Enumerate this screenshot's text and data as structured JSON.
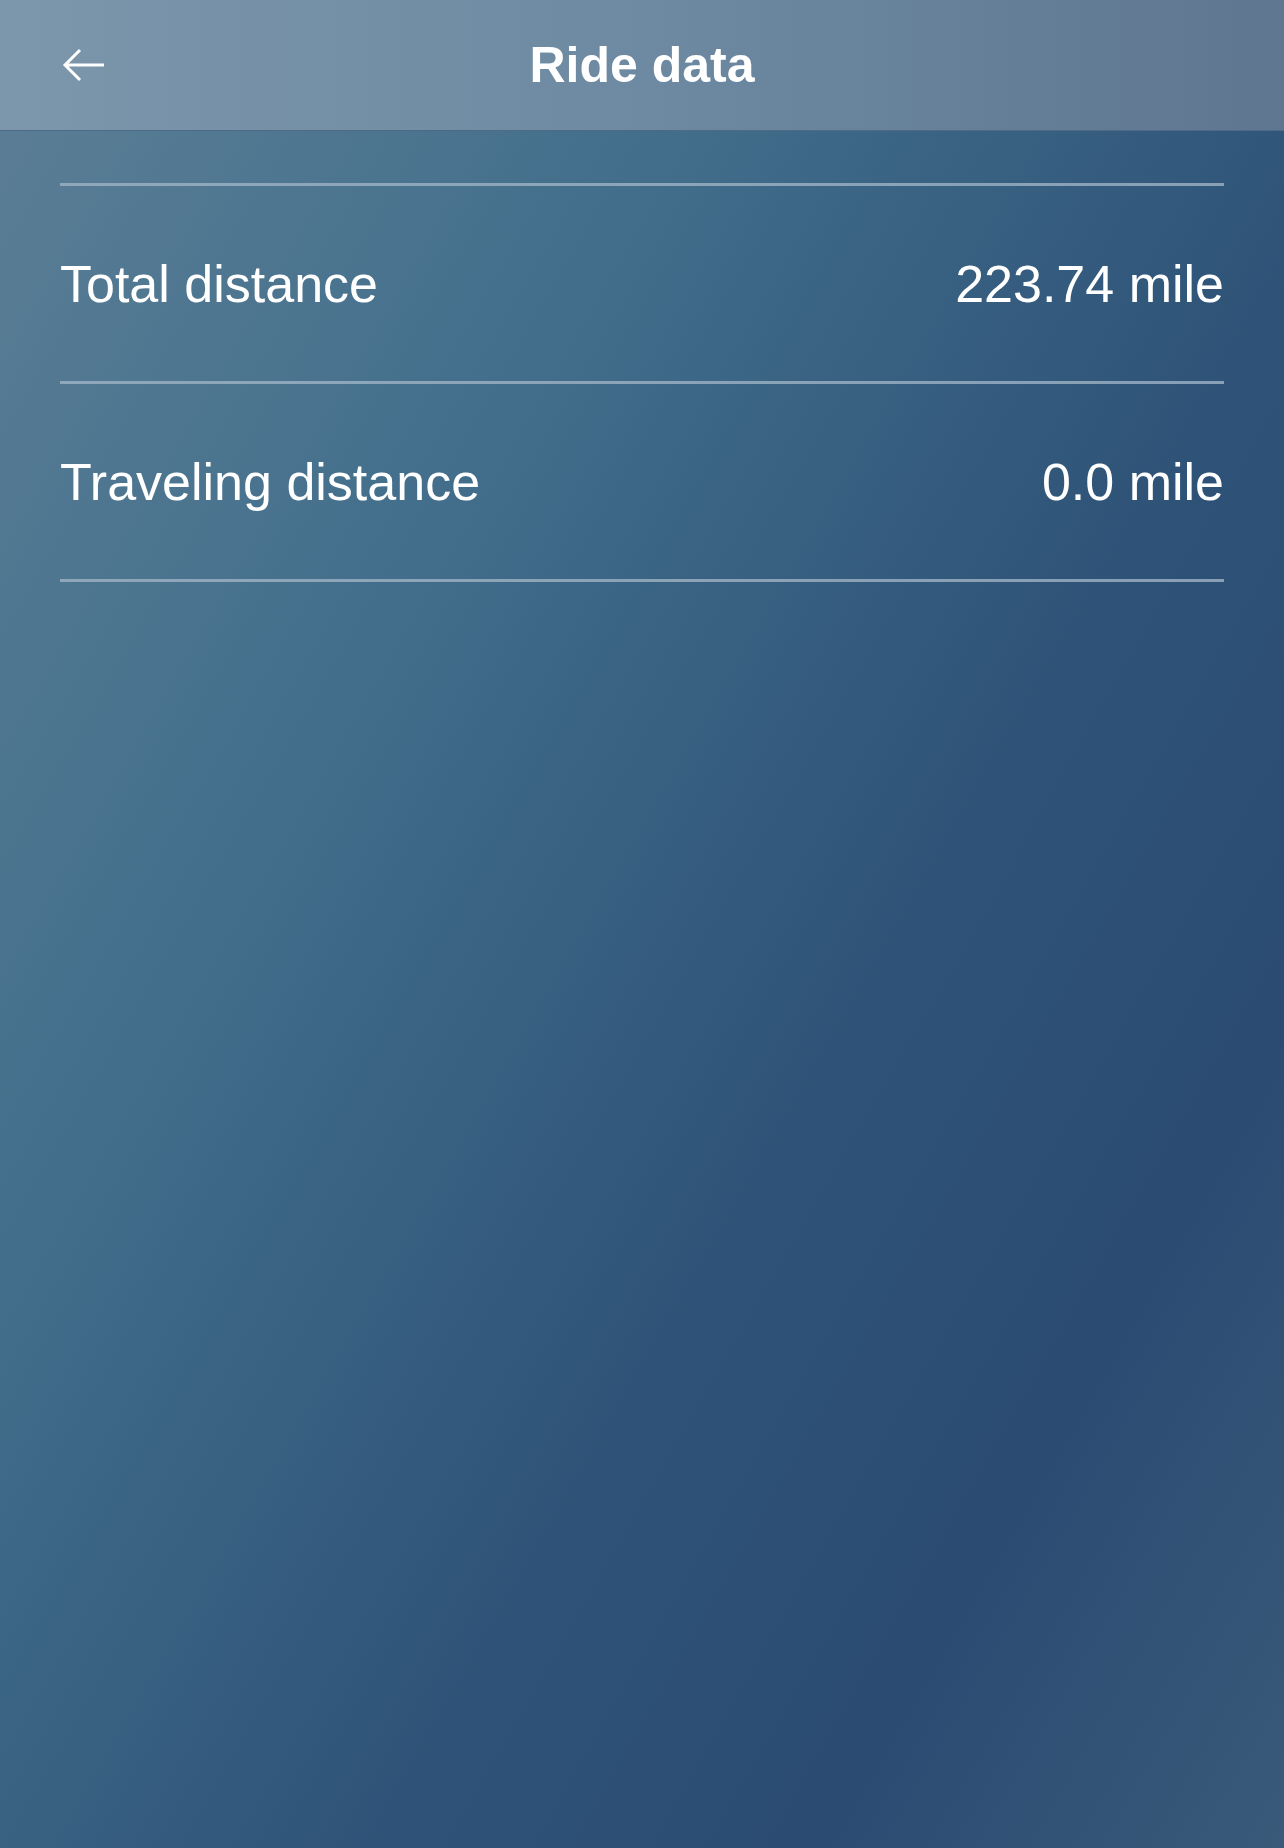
{
  "header": {
    "title": "Ride data"
  },
  "rows": [
    {
      "label": "Total distance",
      "value": "223.74 mile"
    },
    {
      "label": "Traveling distance",
      "value": "0.0 mile"
    }
  ]
}
